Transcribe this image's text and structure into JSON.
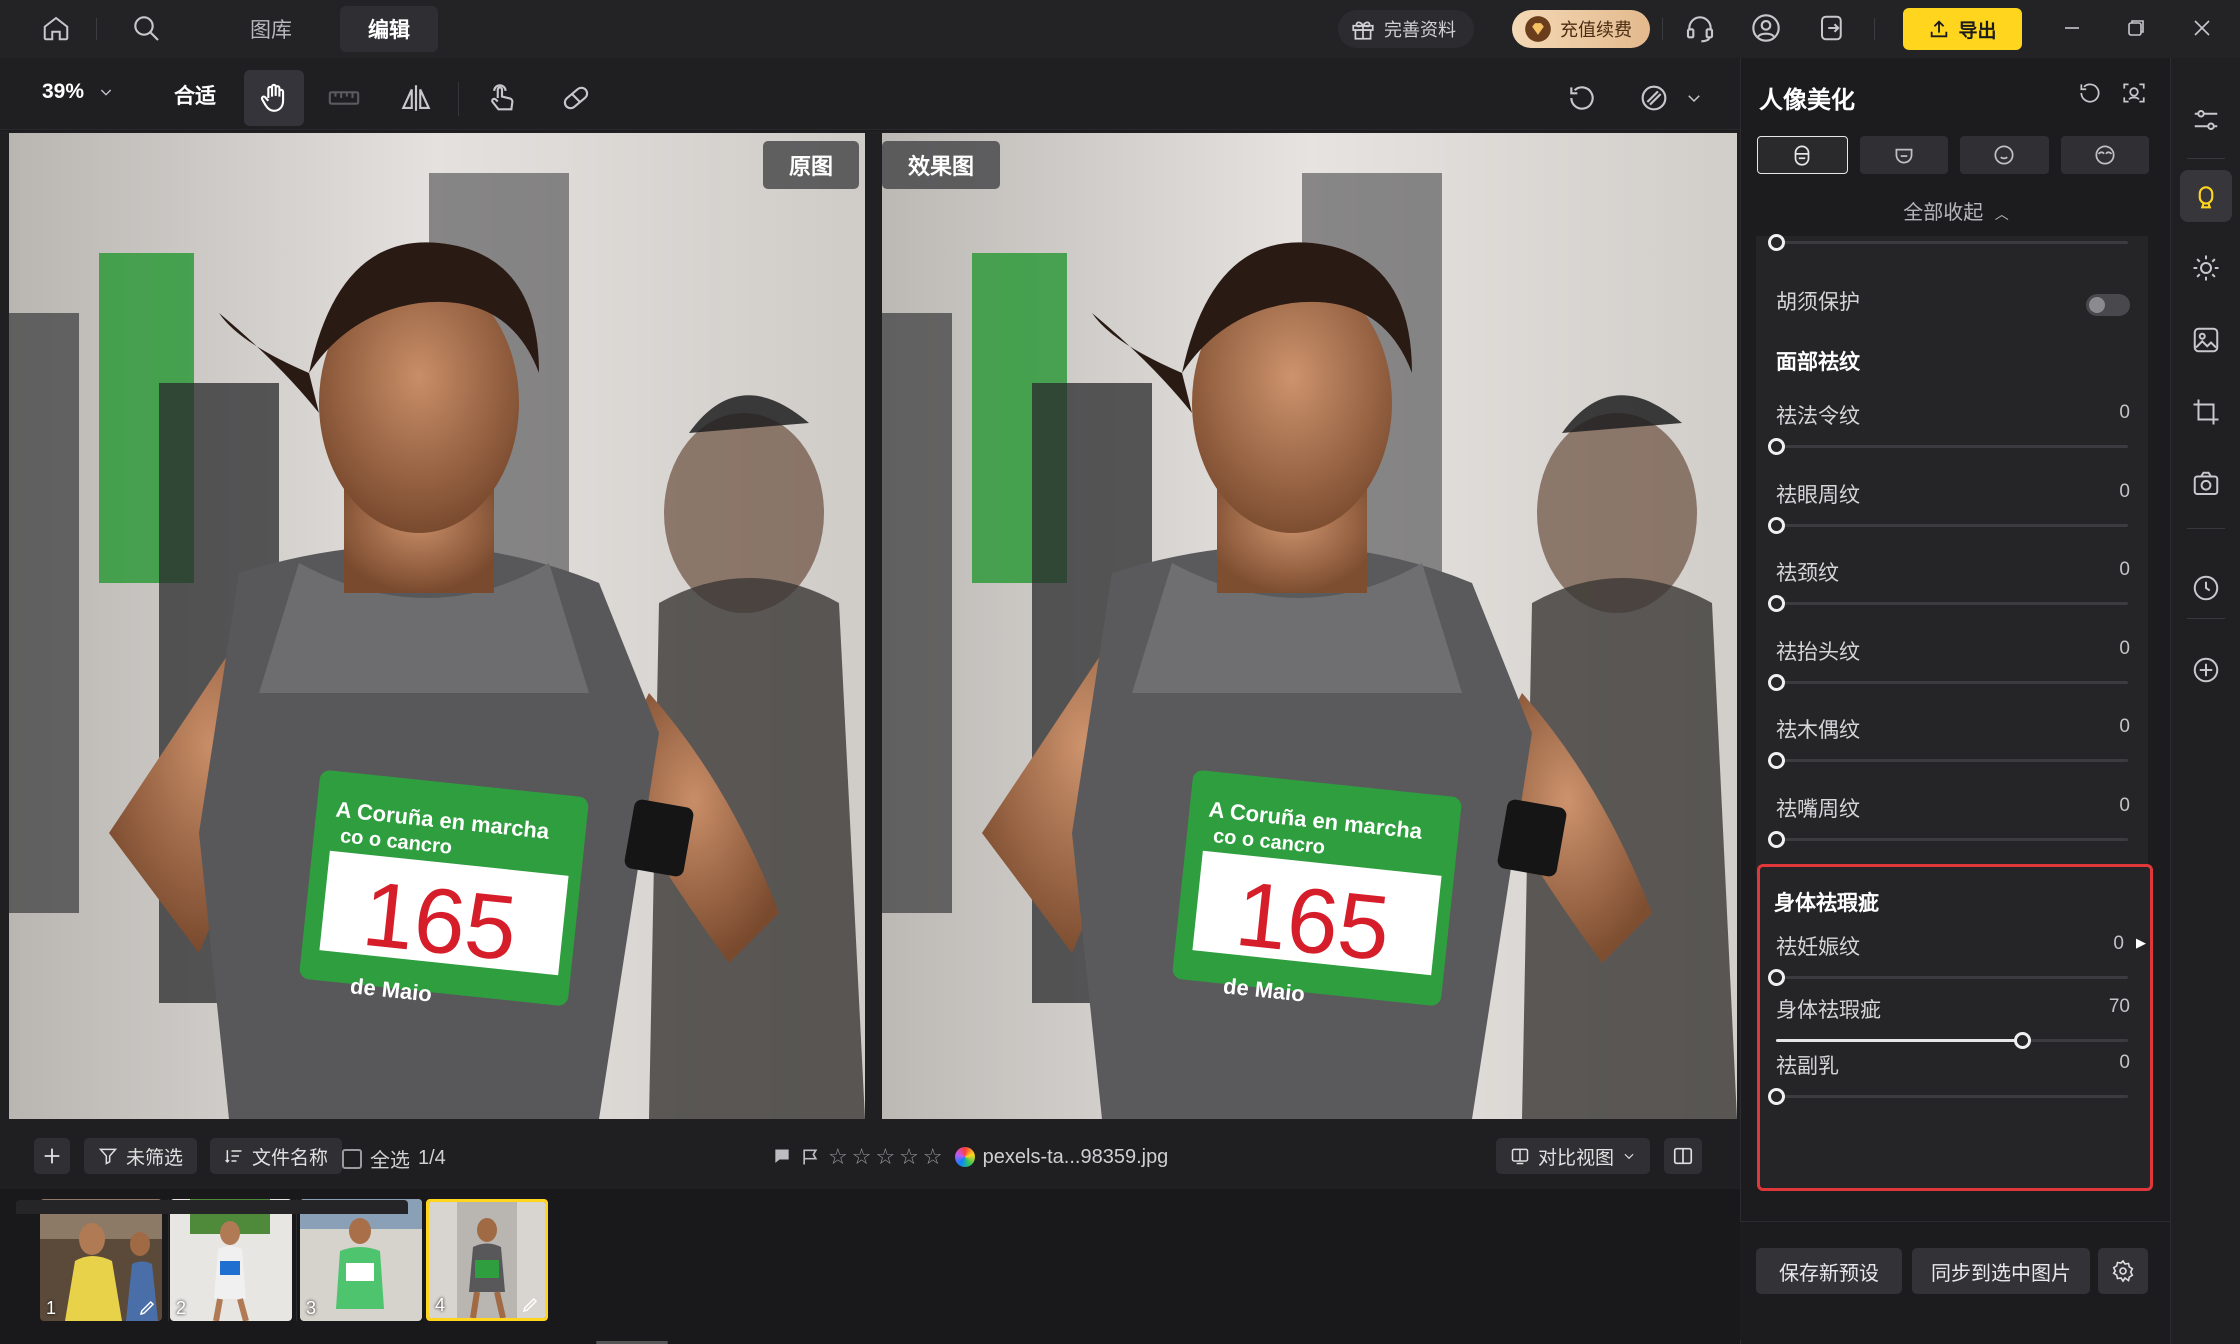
{
  "topbar": {
    "tabs": [
      {
        "label": "图库",
        "active": false
      },
      {
        "label": "编辑",
        "active": true
      }
    ],
    "complete_profile_label": "完善资料",
    "recharge_label": "充值续费",
    "export_label": "导出"
  },
  "toolbar": {
    "zoom_value": "39%",
    "fit_label": "合适"
  },
  "canvas": {
    "original_label": "原图",
    "effect_label": "效果图",
    "bib_number": "165",
    "bib_line1": "A Coruña en marcha",
    "bib_line2": "co o cancro",
    "bib_bottom": "de Maio"
  },
  "filterbar": {
    "unfiltered_label": "未筛选",
    "filename_label": "文件名称",
    "select_all_label": "全选",
    "selection_count": "1/4",
    "filename": "pexels-ta...98359.jpg",
    "compare_view_label": "对比视图"
  },
  "thumbnails": [
    {
      "num": "1",
      "edited": true,
      "active": false
    },
    {
      "num": "2",
      "edited": false,
      "active": false
    },
    {
      "num": "3",
      "edited": false,
      "active": false
    },
    {
      "num": "4",
      "edited": true,
      "active": true
    }
  ],
  "panel": {
    "title": "人像美化",
    "collapse_all_label": "全部收起",
    "beard_protect_label": "胡须保护",
    "beard_protect_on": false,
    "face_wrinkle_section": "面部祛纹",
    "face_sliders": [
      {
        "label": "祛法令纹",
        "value": 0
      },
      {
        "label": "祛眼周纹",
        "value": 0
      },
      {
        "label": "祛颈纹",
        "value": 0
      },
      {
        "label": "祛抬头纹",
        "value": 0
      },
      {
        "label": "祛木偶纹",
        "value": 0
      },
      {
        "label": "祛嘴周纹",
        "value": 0
      }
    ],
    "body_section": "身体祛瑕疵",
    "body_sliders": [
      {
        "label": "祛妊娠纹",
        "value": 0
      },
      {
        "label": "身体祛瑕疵",
        "value": 70
      },
      {
        "label": "祛副乳",
        "value": 0
      }
    ],
    "save_preset_label": "保存新预设",
    "sync_label": "同步到选中图片"
  },
  "colors": {
    "accent_yellow": "#ffd51e",
    "highlight_red": "#e0383a",
    "panel_bg": "#1c1c1f"
  }
}
